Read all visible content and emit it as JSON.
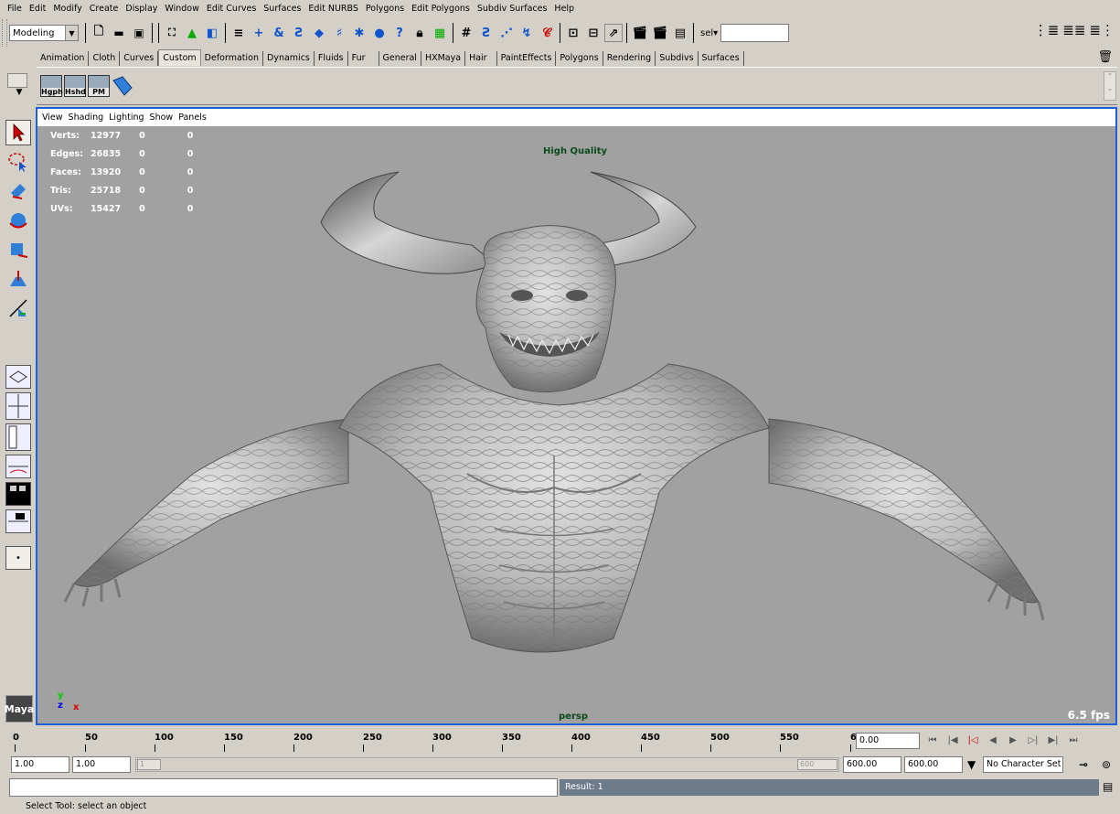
{
  "menubar": {
    "items": [
      "File",
      "Edit",
      "Modify",
      "Create",
      "Display",
      "Window",
      "Edit Curves",
      "Surfaces",
      "Edit NURBS",
      "Polygons",
      "Edit Polygons",
      "Subdiv Surfaces",
      "Help"
    ]
  },
  "statusline": {
    "mode": "Modeling",
    "sel_label": "sel▾",
    "sel_value": ""
  },
  "shelf": {
    "tabs": [
      "Animation",
      "Cloth",
      "Curves",
      "Custom",
      "Deformation",
      "Dynamics",
      "Fluids",
      "Fur",
      "General",
      "HXMaya",
      "Hair",
      "PaintEffects",
      "Polygons",
      "Rendering",
      "Subdivs",
      "Surfaces"
    ],
    "active_tab": "Custom",
    "buttons": [
      "Hgph",
      "Hshd",
      "PM"
    ]
  },
  "panel": {
    "menu": [
      "View",
      "Shading",
      "Lighting",
      "Show",
      "Panels"
    ]
  },
  "hud": {
    "stats": [
      {
        "label": "Verts:",
        "v1": "12977",
        "v2": "0",
        "v3": "0"
      },
      {
        "label": "Edges:",
        "v1": "26835",
        "v2": "0",
        "v3": "0"
      },
      {
        "label": "Faces:",
        "v1": "13920",
        "v2": "0",
        "v3": "0"
      },
      {
        "label": "Tris:",
        "v1": "25718",
        "v2": "0",
        "v3": "0"
      },
      {
        "label": "UVs:",
        "v1": "15427",
        "v2": "0",
        "v3": "0"
      }
    ],
    "quality": "High Quality",
    "camera": "persp",
    "fps": "6.5 fps",
    "axis_y": "y",
    "axis_z": "z",
    "axis_x": "x"
  },
  "timeslider": {
    "ticks": [
      "0",
      "50",
      "100",
      "150",
      "200",
      "250",
      "300",
      "350",
      "400",
      "450",
      "500",
      "550",
      "6"
    ],
    "current_time": "0.00"
  },
  "range": {
    "start": "1.00",
    "playback_start": "1.00",
    "range_left": "1",
    "range_right": "600",
    "playback_end": "600.00",
    "end": "600.00",
    "character_set": "No Character Set"
  },
  "commandline": {
    "result": "Result: 1"
  },
  "helpline": {
    "text": "Select Tool: select an object"
  },
  "logo": "Maya",
  "colors": {
    "panel_border": "#1c5fd8",
    "viewport_bg": "#a1a1a1",
    "hud_green": "#0b4a1a"
  }
}
